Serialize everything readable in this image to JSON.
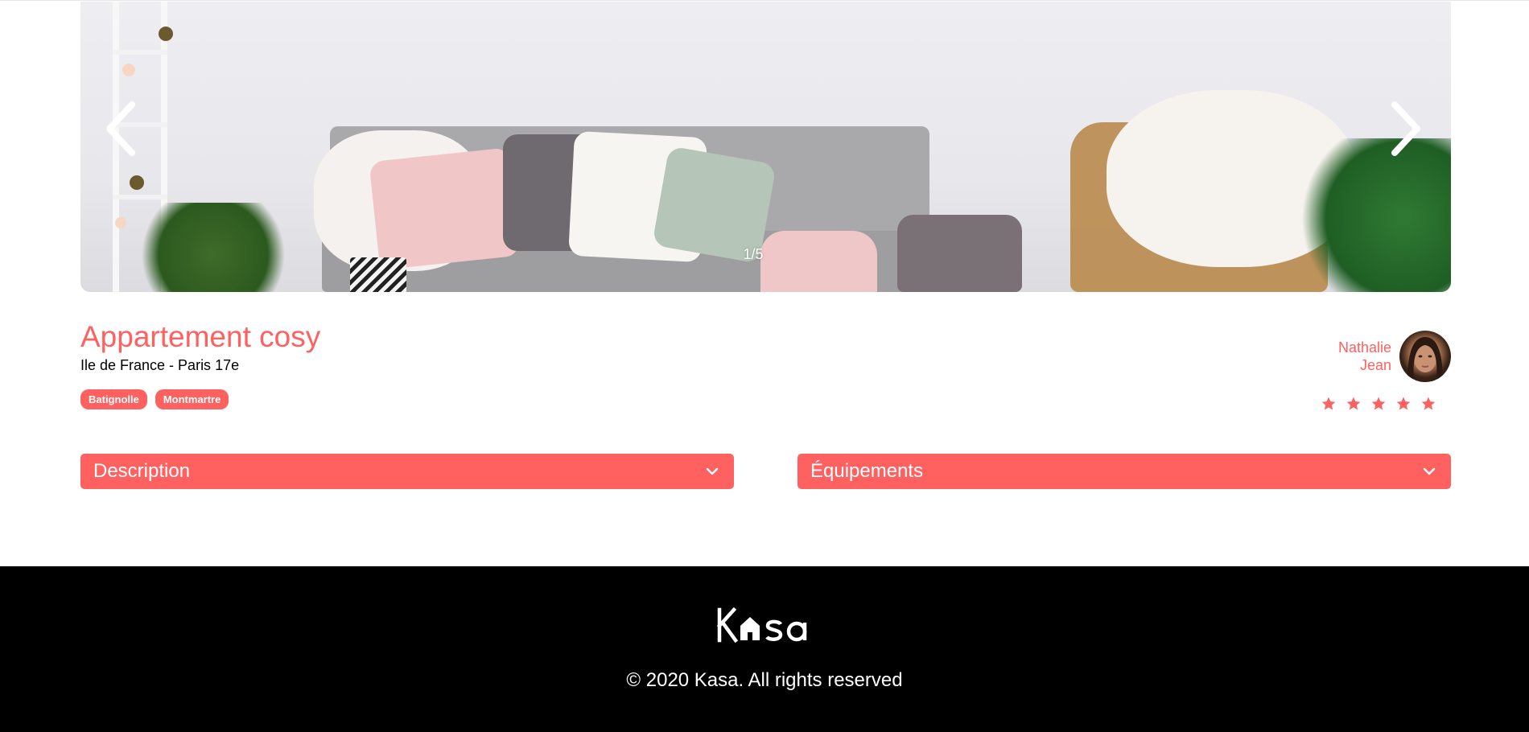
{
  "gallery": {
    "image_alt": "Appartement cosy - photo",
    "counter": "1/5",
    "prev_icon": "chevron-left-icon",
    "next_icon": "chevron-right-icon"
  },
  "listing": {
    "title": "Appartement cosy",
    "location": "Ile de France - Paris 17e",
    "tags": [
      "Batignolle",
      "Montmartre"
    ]
  },
  "host": {
    "name_line1": "Nathalie",
    "name_line2": "Jean",
    "rating": 5,
    "rating_max": 5
  },
  "collapses": {
    "description": "Description",
    "equipments": "Équipements"
  },
  "footer": {
    "logo_text": "Kasa",
    "copyright": "© 2020 Kasa. All rights reserved"
  },
  "colors": {
    "accent": "#ff6060",
    "footer_bg": "#000000",
    "text": "#000000",
    "star_inactive": "#e3e3e3"
  }
}
